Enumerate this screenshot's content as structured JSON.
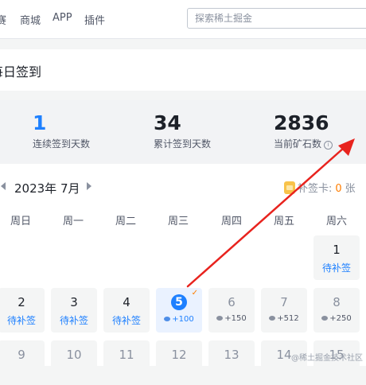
{
  "nav": {
    "items": [
      "赛",
      "商城",
      "APP",
      "插件"
    ],
    "search_placeholder": "探索稀土掘金"
  },
  "title": "每日签到",
  "stats": [
    {
      "value": "1",
      "label": "连续签到天数",
      "color": "#1e80ff"
    },
    {
      "value": "34",
      "label": "累计签到天数",
      "color": "#1d2129"
    },
    {
      "value": "2836",
      "label": "当前矿石数",
      "color": "#1d2129"
    }
  ],
  "calendar": {
    "month": "2023年 7月",
    "makeup_label": "补签卡:",
    "makeup_count": "0",
    "makeup_unit": "张",
    "weekdays": [
      "周日",
      "周一",
      "周二",
      "周三",
      "周四",
      "周五",
      "周六"
    ],
    "days": [
      {
        "day": "1",
        "status": "待补签"
      },
      {
        "day": "2",
        "status": "待补签"
      },
      {
        "day": "3",
        "status": "待补签"
      },
      {
        "day": "4",
        "status": "待补签"
      },
      {
        "day": "5",
        "reward": "+100",
        "checked_mark": "✓"
      },
      {
        "day": "6",
        "reward": "+150"
      },
      {
        "day": "7",
        "reward": "+512"
      },
      {
        "day": "8",
        "reward": "+250"
      },
      {
        "day": "9"
      },
      {
        "day": "10"
      },
      {
        "day": "11"
      },
      {
        "day": "12"
      },
      {
        "day": "13"
      },
      {
        "day": "14"
      },
      {
        "day": "15"
      }
    ]
  },
  "watermark": "@稀土掘金技术社区",
  "colors": {
    "accent": "#1e80ff",
    "annotation_arrow": "#e8231e",
    "makeup_count": "#ff7d00"
  }
}
